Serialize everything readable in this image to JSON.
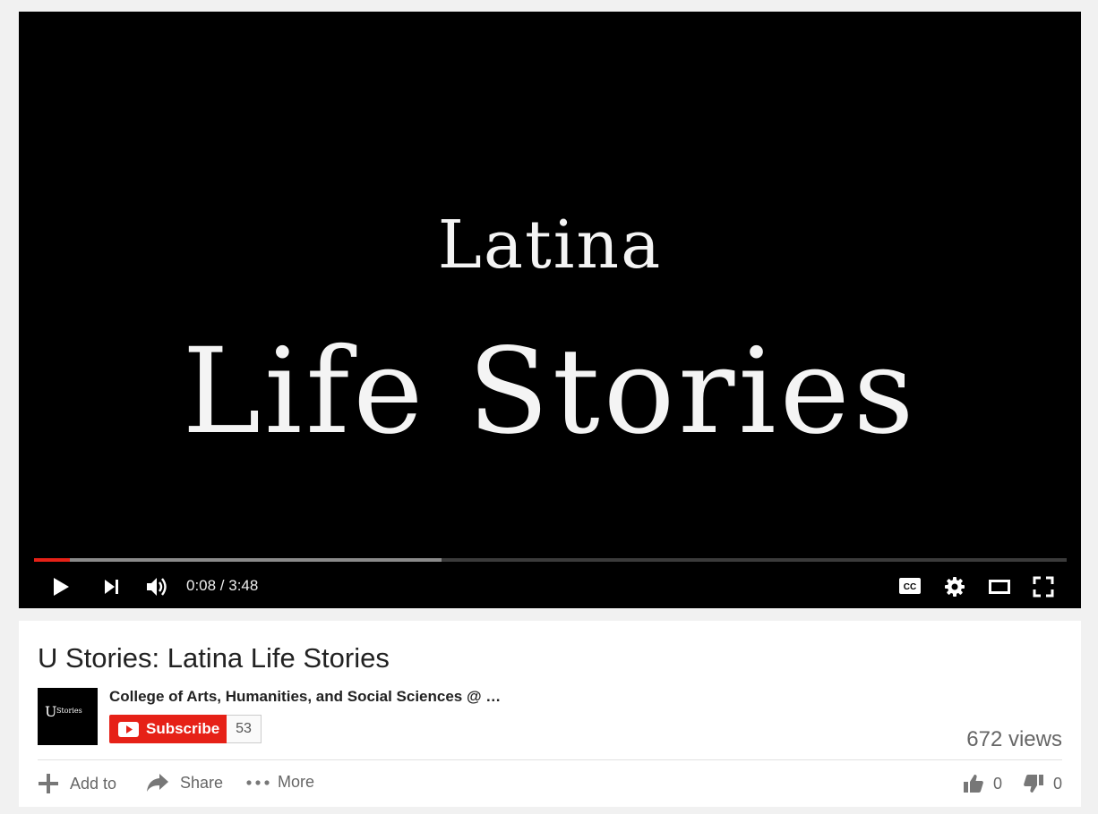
{
  "video": {
    "frame_title_line1": "Latina",
    "frame_title_line2": "Life Stories",
    "time_current": "0:08",
    "time_total": "3:48",
    "time_display": "0:08 / 3:48",
    "progress_fraction": 0.035,
    "buffered_fraction": 0.395,
    "colors": {
      "progress": "#e62117",
      "buffer": "#8a8a8a",
      "background": "#000000"
    },
    "controls_icons": [
      "play-icon",
      "next-icon",
      "volume-icon",
      "cc-icon",
      "settings-icon",
      "theater-icon",
      "fullscreen-icon"
    ]
  },
  "info": {
    "title": "U Stories: Latina Life Stories",
    "channel_name": "College of Arts, Humanities, and Social Sciences @ …",
    "avatar_letter": "U",
    "avatar_word": "Stories",
    "subscribe_label": "Subscribe",
    "subscriber_count": "53",
    "views": "672 views",
    "actions": {
      "add_to": "Add to",
      "share": "Share",
      "more": "More"
    },
    "likes": "0",
    "dislikes": "0",
    "colors": {
      "subscribe": "#e62117"
    }
  }
}
